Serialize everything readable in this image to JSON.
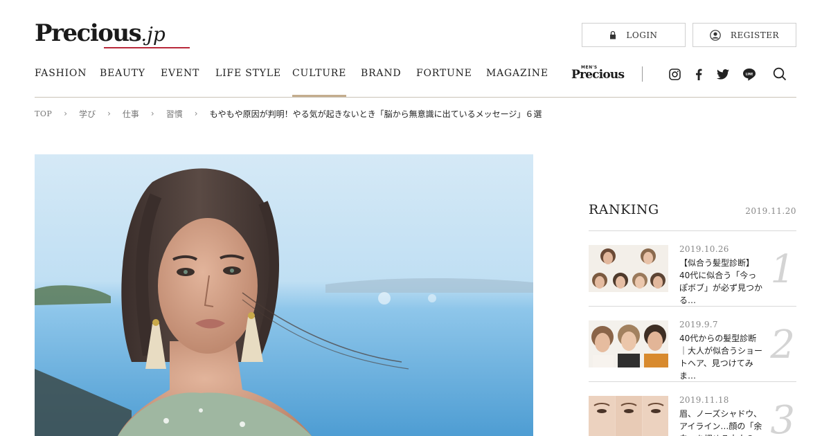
{
  "header": {
    "logo_text": "Precious",
    "logo_suffix": ".jp",
    "login_label": "LOGIN",
    "register_label": "REGISTER"
  },
  "nav": {
    "items": [
      {
        "label": "FASHION",
        "active": false
      },
      {
        "label": "BEAUTY",
        "active": false
      },
      {
        "label": "EVENT",
        "active": false
      },
      {
        "label": "LIFE STYLE",
        "active": false
      },
      {
        "label": "CULTURE",
        "active": true
      },
      {
        "label": "BRAND",
        "active": false
      },
      {
        "label": "FORTUNE",
        "active": false
      },
      {
        "label": "MAGAZINE",
        "active": false
      }
    ],
    "mens_logo_top": "MEN'S",
    "mens_logo_main": "Precious",
    "social_icons": [
      "instagram-icon",
      "facebook-icon",
      "twitter-icon",
      "line-icon",
      "search-icon"
    ]
  },
  "breadcrumb": {
    "items": [
      "TOP",
      "学び",
      "仕事",
      "習慣"
    ],
    "current": "もやもや原因が判明！やる気が起きないとき「脳から無意識に出ているメッセージ」６選"
  },
  "colors": {
    "accent_underline": "#c4ad8e",
    "logo_underline": "#b8283a"
  },
  "ranking": {
    "title": "RANKING",
    "date": "2019.11.20",
    "items": [
      {
        "rank": "1",
        "date": "2019.10.26",
        "title": "【似合う髪型診断】40代に似合う「今っぽボブ」が必ず見つかる…"
      },
      {
        "rank": "2",
        "date": "2019.9.7",
        "title": "40代からの髪型診断｜大人が似合うショートヘア、見つけてみま…"
      },
      {
        "rank": "3",
        "date": "2019.11.18",
        "title": "眉、ノーズシャドウ、アイライン…顔の「余白」を埋める大人のメ…"
      }
    ]
  }
}
